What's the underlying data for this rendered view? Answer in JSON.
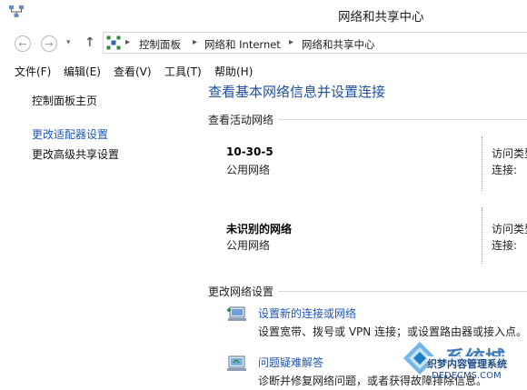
{
  "window": {
    "title": "网络和共享中心"
  },
  "breadcrumb": [
    "控制面板",
    "网络和 Internet",
    "网络和共享中心"
  ],
  "menu": [
    "文件(F)",
    "编辑(E)",
    "查看(V)",
    "工具(T)",
    "帮助(H)"
  ],
  "sidebar": {
    "items": [
      {
        "label": "控制面板主页"
      },
      {
        "label": "更改适配器设置"
      },
      {
        "label": "更改高级共享设置"
      }
    ]
  },
  "main": {
    "title": "查看基本网络信息并设置连接",
    "active_section": "查看活动网络",
    "networks": [
      {
        "name": "10-30-5",
        "type": "公用网络",
        "access_label": "访问类型",
        "conn_label": "连接:"
      },
      {
        "name": "未识别的网络",
        "type": "公用网络",
        "access_label": "访问类型",
        "conn_label": "连接:"
      }
    ],
    "change_section": "更改网络设置",
    "actions": [
      {
        "label": "设置新的连接或网络",
        "desc": "设置宽带、拨号或 VPN 连接；或设置路由器或接入点。"
      },
      {
        "label": "问题疑难解答",
        "desc": "诊断并修复网络问题，或者获得故障排除信息。"
      }
    ]
  },
  "watermark": {
    "text": "系统城",
    "sub": "织梦内容管理系统",
    "domain": "DEDECMS.COM"
  },
  "colors": {
    "link": "#1e56b5",
    "title": "#1e4fa0"
  }
}
